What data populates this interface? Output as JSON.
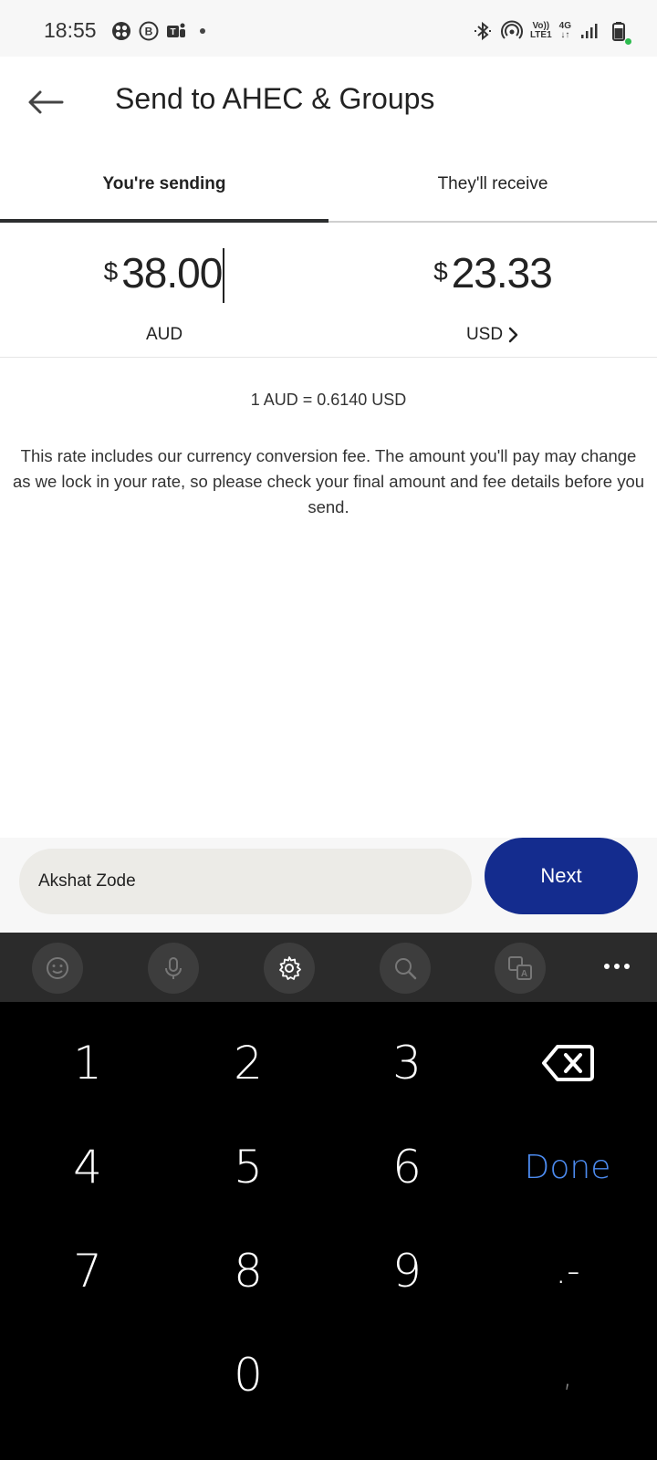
{
  "status_bar": {
    "time": "18:55",
    "network_top": "Vo))",
    "network_bottom": "LTE1",
    "gen_top": "4G",
    "gen_bottom": "↓↑"
  },
  "header": {
    "title": "Send to AHEC & Groups"
  },
  "tabs": [
    {
      "label": "You're sending"
    },
    {
      "label": "They'll receive"
    }
  ],
  "sending": {
    "symbol": "$",
    "amount": "38.00",
    "currency": "AUD"
  },
  "receiving": {
    "symbol": "$",
    "amount": "23.33",
    "currency": "USD"
  },
  "rate_text": "1 AUD = 0.6140 USD",
  "disclaimer": "This rate includes our currency conversion fee. The amount you'll pay may change as we lock in your rate, so please check your final amount and fee details before you send.",
  "note_field": {
    "value": "Akshat Zode"
  },
  "next_label": "Next",
  "keyboard": {
    "toolbar_icons": [
      "emoji-icon",
      "microphone-icon",
      "settings-icon",
      "search-icon",
      "translate-icon",
      "more-icon"
    ],
    "keys": [
      "1",
      "2",
      "3",
      "4",
      "5",
      "6",
      "Done",
      "7",
      "8",
      "9",
      ".-",
      "0",
      ","
    ],
    "done_label": "Done",
    "accent_color": "#4c8bf0"
  },
  "colors": {
    "next_button": "#142c8e",
    "active_tab_underline": "#2c2e2f",
    "keyboard_bg": "#000000"
  }
}
